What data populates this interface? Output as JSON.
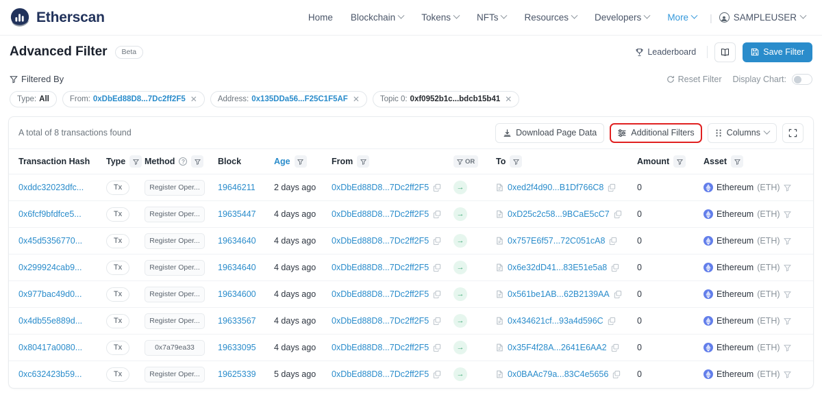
{
  "nav": {
    "brand": "Etherscan",
    "brand_icon": "etherscan-logo-icon",
    "links": [
      {
        "label": "Home",
        "has_caret": false
      },
      {
        "label": "Blockchain",
        "has_caret": true
      },
      {
        "label": "Tokens",
        "has_caret": true
      },
      {
        "label": "NFTs",
        "has_caret": true
      },
      {
        "label": "Resources",
        "has_caret": true
      },
      {
        "label": "Developers",
        "has_caret": true
      },
      {
        "label": "More",
        "has_caret": true
      }
    ],
    "more_color": "#3498db",
    "user": "SAMPLEUSER"
  },
  "header": {
    "title": "Advanced Filter",
    "badge": "Beta",
    "leaderboard": "Leaderboard",
    "leaderboard_icon": "trophy-icon",
    "book_icon": "book-icon",
    "save_filter": "Save Filter",
    "save_filter_icon": "save-disk-icon",
    "save_filter_color": "#2a8ccb"
  },
  "filtered": {
    "label": "Filtered By",
    "label_icon": "funnel-icon",
    "reset": "Reset Filter",
    "reset_icon": "refresh-icon",
    "display_chart": "Display Chart:",
    "display_chart_on": false,
    "chips": [
      {
        "key": "Type:",
        "value": "All",
        "value_is_link": false,
        "closable": false
      },
      {
        "key": "From:",
        "value": "0xDbEd88D8...7Dc2ff2F5",
        "value_is_link": true,
        "closable": true
      },
      {
        "key": "Address:",
        "value": "0x135DDa56...F25C1F5AF",
        "value_is_link": true,
        "closable": true
      },
      {
        "key": "Topic 0:",
        "value": "0xf0952b1c...bdcb15b41",
        "value_is_link": false,
        "closable": true
      }
    ]
  },
  "table_toolbar": {
    "total_text": "A total of 8 transactions found",
    "download": "Download Page Data",
    "download_icon": "download-icon",
    "additional_filters": "Additional Filters",
    "additional_filters_icon": "sliders-icon",
    "additional_filters_highlighted": true,
    "highlight_color": "#e02020",
    "columns": "Columns",
    "columns_icon": "grid-dots-icon",
    "expand_icon": "fullscreen-icon"
  },
  "table": {
    "headers": [
      {
        "label": "Transaction Hash",
        "filter": "none",
        "link": false
      },
      {
        "label": "Type",
        "filter": "box",
        "link": false
      },
      {
        "label": "Method",
        "filter": "box",
        "link": false,
        "help": true
      },
      {
        "label": "Block",
        "filter": "none",
        "link": false
      },
      {
        "label": "Age",
        "filter": "box",
        "link": true
      },
      {
        "label": "From",
        "filter": "box",
        "link": false
      },
      {
        "label": "OR",
        "filter": "or",
        "link": false
      },
      {
        "label": "To",
        "filter": "box",
        "link": false
      },
      {
        "label": "Amount",
        "filter": "box",
        "link": false
      },
      {
        "label": "Asset",
        "filter": "box",
        "link": false
      }
    ],
    "rows": [
      {
        "hash": "0xddc32023dfc...",
        "type": "Tx",
        "method": "Register Oper...",
        "block": "19646211",
        "age": "2 days ago",
        "from": "0xDbEd88D8...7Dc2ff2F5",
        "direction": "→",
        "to": "0xed2f4d90...B1Df766C8",
        "amount": "0",
        "asset": "Ethereum",
        "asset_symbol": "(ETH)"
      },
      {
        "hash": "0x6fcf9bfdfce5...",
        "type": "Tx",
        "method": "Register Oper...",
        "block": "19635447",
        "age": "4 days ago",
        "from": "0xDbEd88D8...7Dc2ff2F5",
        "direction": "→",
        "to": "0xD25c2c58...9BCaE5cC7",
        "amount": "0",
        "asset": "Ethereum",
        "asset_symbol": "(ETH)"
      },
      {
        "hash": "0x45d5356770...",
        "type": "Tx",
        "method": "Register Oper...",
        "block": "19634640",
        "age": "4 days ago",
        "from": "0xDbEd88D8...7Dc2ff2F5",
        "direction": "→",
        "to": "0x757E6f57...72C051cA8",
        "amount": "0",
        "asset": "Ethereum",
        "asset_symbol": "(ETH)"
      },
      {
        "hash": "0x299924cab9...",
        "type": "Tx",
        "method": "Register Oper...",
        "block": "19634640",
        "age": "4 days ago",
        "from": "0xDbEd88D8...7Dc2ff2F5",
        "direction": "→",
        "to": "0x6e32dD41...83E51e5a8",
        "amount": "0",
        "asset": "Ethereum",
        "asset_symbol": "(ETH)"
      },
      {
        "hash": "0x977bac49d0...",
        "type": "Tx",
        "method": "Register Oper...",
        "block": "19634600",
        "age": "4 days ago",
        "from": "0xDbEd88D8...7Dc2ff2F5",
        "direction": "→",
        "to": "0x561be1AB...62B2139AA",
        "amount": "0",
        "asset": "Ethereum",
        "asset_symbol": "(ETH)"
      },
      {
        "hash": "0x4db55e889d...",
        "type": "Tx",
        "method": "Register Oper...",
        "block": "19633567",
        "age": "4 days ago",
        "from": "0xDbEd88D8...7Dc2ff2F5",
        "direction": "→",
        "to": "0x434621cf...93a4d596C",
        "amount": "0",
        "asset": "Ethereum",
        "asset_symbol": "(ETH)"
      },
      {
        "hash": "0x80417a0080...",
        "type": "Tx",
        "method": "0x7a79ea33",
        "block": "19633095",
        "age": "4 days ago",
        "from": "0xDbEd88D8...7Dc2ff2F5",
        "direction": "→",
        "to": "0x35F4f28A...2641E6AA2",
        "amount": "0",
        "asset": "Ethereum",
        "asset_symbol": "(ETH)"
      },
      {
        "hash": "0xc632423b59...",
        "type": "Tx",
        "method": "Register Oper...",
        "block": "19625339",
        "age": "5 days ago",
        "from": "0xDbEd88D8...7Dc2ff2F5",
        "direction": "→",
        "to": "0x0BAAc79a...83C4e5656",
        "amount": "0",
        "asset": "Ethereum",
        "asset_symbol": "(ETH)"
      }
    ]
  }
}
